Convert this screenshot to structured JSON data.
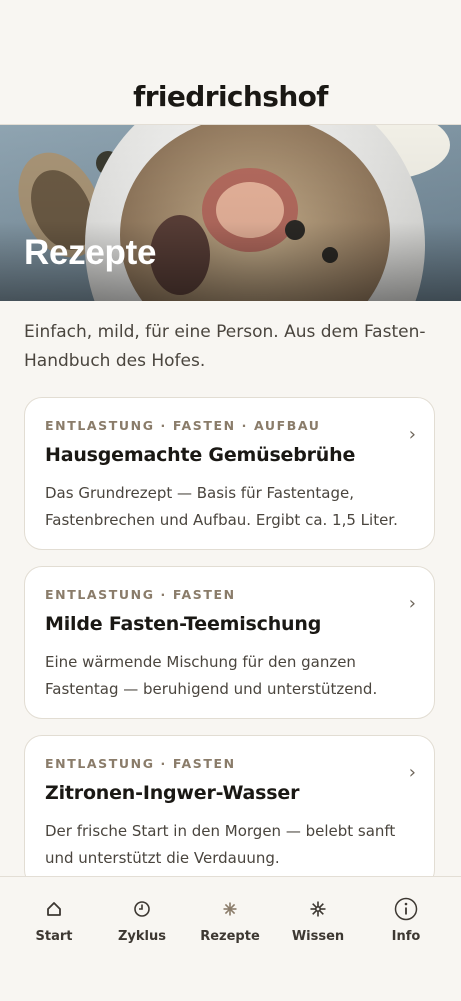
{
  "header": {
    "logo": "friedrichshof"
  },
  "hero": {
    "title": "Rezepte"
  },
  "intro": "Einfach, mild, für eine Person. Aus dem Fasten-Handbuch des Hofes.",
  "recipes": [
    {
      "tags": "ENTLASTUNG · FASTEN · AUFBAU",
      "title": "Hausgemachte Gemüsebrühe",
      "description": "Das Grundrezept — Basis für Fastentage, Fastenbrechen und Aufbau. Ergibt ca. 1,5 Liter."
    },
    {
      "tags": "ENTLASTUNG · FASTEN",
      "title": "Milde Fasten-Teemischung",
      "description": "Eine wärmende Mischung für den ganzen Fastentag — beruhigend und unterstützend."
    },
    {
      "tags": "ENTLASTUNG · FASTEN",
      "title": "Zitronen-Ingwer-Wasser",
      "description": "Der frische Start in den Morgen — belebt sanft und unterstützt die Verdauung."
    }
  ],
  "chevron": "›",
  "tabs": [
    {
      "label": "Start",
      "icon": "home-icon"
    },
    {
      "label": "Zyklus",
      "icon": "clock-icon"
    },
    {
      "label": "Rezepte",
      "icon": "sparkle-icon"
    },
    {
      "label": "Wissen",
      "icon": "snowflake-icon"
    },
    {
      "label": "Info",
      "icon": "info-icon"
    }
  ],
  "colors": {
    "background": "#f8f6f2",
    "card": "#ffffff",
    "tag": "#8a7c6a",
    "text": "#1a1814"
  }
}
